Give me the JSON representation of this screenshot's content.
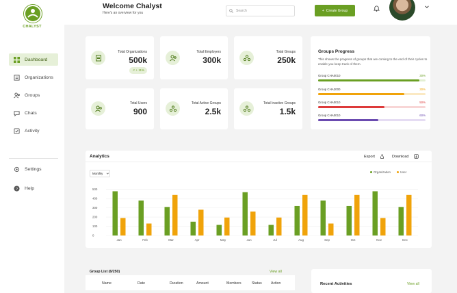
{
  "app": {
    "logo_text": "CHALYST"
  },
  "sidebar": {
    "items": [
      {
        "label": "Dashboard",
        "icon": "dashboard-icon",
        "active": true
      },
      {
        "label": "Organizations",
        "icon": "building-icon",
        "active": false
      },
      {
        "label": "Groups",
        "icon": "users-icon",
        "active": false
      },
      {
        "label": "Chats",
        "icon": "chat-icon",
        "active": false
      },
      {
        "label": "Activity",
        "icon": "activity-icon",
        "active": false
      }
    ],
    "bottom_items": [
      {
        "label": "Settings",
        "icon": "gear-icon"
      },
      {
        "label": "Help",
        "icon": "help-icon"
      }
    ]
  },
  "header": {
    "title": "Welcome Chalyst",
    "subtitle": "Here's an overview for you",
    "search_placeholder": "Search",
    "create_button": "Create Group"
  },
  "stats": [
    {
      "title": "Total Organizations",
      "value": "500k",
      "badge": "↗ + 11%",
      "icon": "organization-icon"
    },
    {
      "title": "Total Employers",
      "value": "300k",
      "icon": "employers-icon"
    },
    {
      "title": "Total Groups",
      "value": "250k",
      "icon": "groups-icon"
    },
    {
      "title": "Total Users",
      "value": "900",
      "icon": "users-icon"
    },
    {
      "title": "Total Active Groups",
      "value": "2.5k",
      "icon": "active-groups-icon"
    },
    {
      "title": "Total Inactive Groups",
      "value": "1.5k",
      "icon": "inactive-groups-icon"
    }
  ],
  "groups_progress": {
    "title": "Groups Progress",
    "description": "This shows the progress of groups that are coming to the end of their cycles to enable you keep track of them.",
    "items": [
      {
        "name": "Group CHA0010",
        "percent_label": "30%",
        "progress": 0.94,
        "color": "#6a9f23",
        "track": "#e3efd2"
      },
      {
        "name": "Group CHA2000",
        "percent_label": "30%",
        "progress": 0.8,
        "color": "#f0a30a",
        "track": "#fbe9c3"
      },
      {
        "name": "Group CHA0010",
        "percent_label": "50%",
        "progress": 0.62,
        "color": "#dd3a3a",
        "track": "#f8d6d6"
      },
      {
        "name": "Group CHA0010",
        "percent_label": "60%",
        "progress": 0.56,
        "color": "#6b4bb0",
        "track": "#e5dcf3"
      }
    ]
  },
  "analytics": {
    "title": "Analytics",
    "export_label": "Export",
    "download_label": "Download",
    "period": "Monthly",
    "legend": [
      "Organization",
      "User"
    ]
  },
  "chart_data": {
    "type": "bar",
    "categories": [
      "Jan",
      "Feb",
      "Mar",
      "Apr",
      "May",
      "Jun",
      "Jul",
      "Aug",
      "Sep",
      "Oct",
      "Nov",
      "Dec"
    ],
    "series": [
      {
        "name": "Organization",
        "color": "#6a9f23",
        "values": [
          480,
          380,
          310,
          150,
          115,
          470,
          115,
          320,
          380,
          320,
          480,
          310
        ]
      },
      {
        "name": "User",
        "color": "#f0a30a",
        "values": [
          190,
          130,
          440,
          280,
          195,
          260,
          195,
          440,
          130,
          440,
          190,
          440
        ]
      }
    ],
    "yticks": [
      0,
      100,
      200,
      300,
      400,
      500
    ],
    "ylim": [
      0,
      550
    ],
    "grid": true,
    "legend_position": "top-right"
  },
  "group_list": {
    "title": "Group List (6/250)",
    "view_all": "View all",
    "columns": [
      "Name",
      "Date",
      "Duration",
      "Amount",
      "Members",
      "Status",
      "Action"
    ]
  },
  "recent_activities": {
    "title": "Recent Activities",
    "view_all": "View all"
  },
  "colors": {
    "brand": "#6a9f23",
    "brand_light": "#e6f0d8",
    "orange": "#f0a30a"
  }
}
